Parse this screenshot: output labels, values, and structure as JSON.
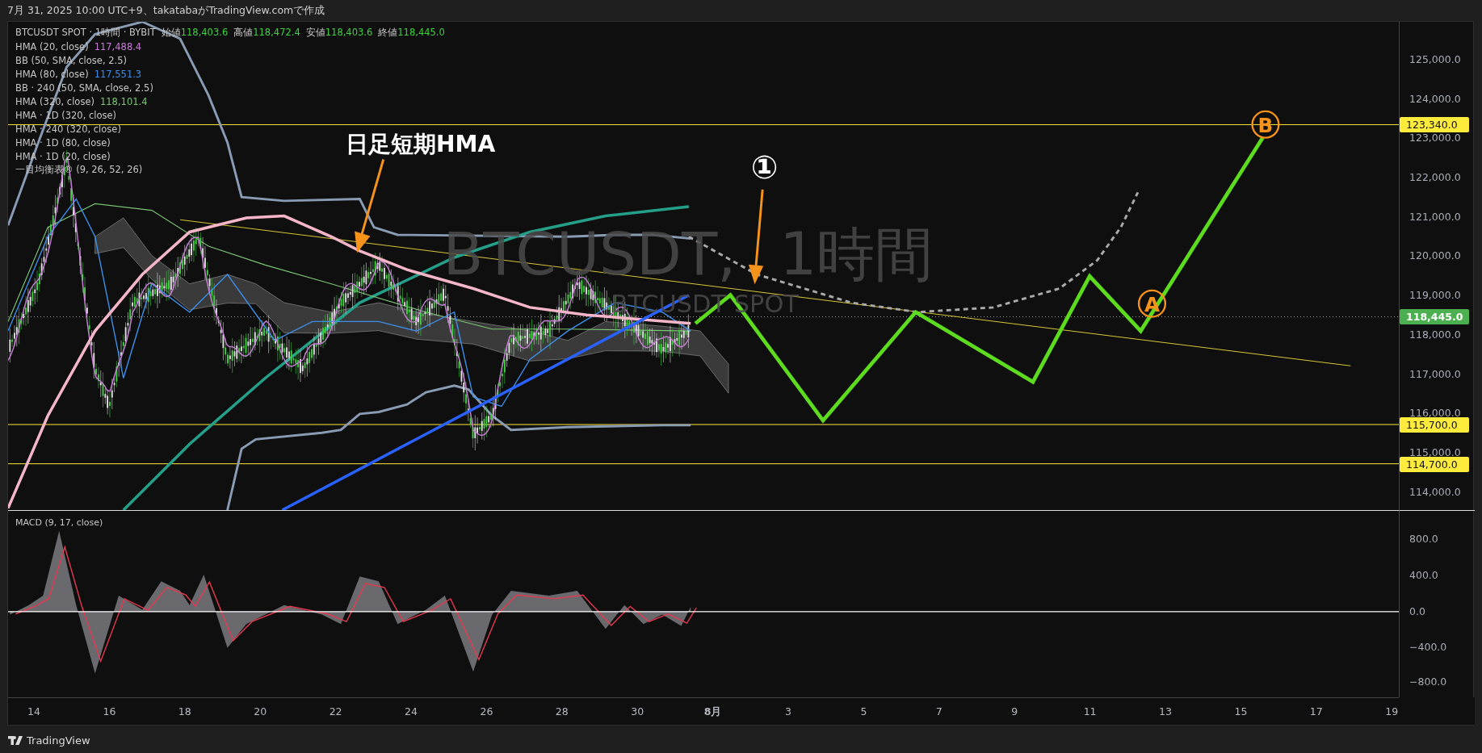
{
  "header": {
    "caption": "7月 31, 2025 10:00 UTC+9、takatabaがTradingView.comで作成"
  },
  "legend": {
    "symbol": "BTCUSDT SPOT · 1時間 · BYBIT",
    "ohlc": [
      {
        "label": "始値",
        "value": "118,403.6"
      },
      {
        "label": "高値",
        "value": "118,472.4"
      },
      {
        "label": "安値",
        "value": "118,403.6"
      },
      {
        "label": "終値",
        "value": "118,445.0"
      }
    ],
    "indicators": [
      {
        "name": "HMA (20, close)",
        "value": "117,488.4",
        "color": "#c77dd6"
      },
      {
        "name": "BB (50, SMA, close, 2.5)"
      },
      {
        "name": "HMA (80, close)",
        "value": "117,551.3",
        "color": "#3d8ee8"
      },
      {
        "name": "BB · 240 (50, SMA, close, 2.5)"
      },
      {
        "name": "HMA (320, close)",
        "value": "118,101.4",
        "color": "#7cc576"
      },
      {
        "name": "HMA · 1D (320, close)"
      },
      {
        "name": "HMA · 240 (320, close)"
      },
      {
        "name": "HMA · 1D (80, close)"
      },
      {
        "name": "HMA · 1D (20, close)"
      },
      {
        "name": "一目均衡表® (9, 26, 52, 26)"
      }
    ]
  },
  "watermark": {
    "symbol": "BTCUSDT,",
    "interval": "1時間",
    "subtitle": "BTCUSDT SPOT"
  },
  "annotations": {
    "callout": "日足短期HMA",
    "marker": "①",
    "points": [
      {
        "letter": "A"
      },
      {
        "letter": "B"
      }
    ]
  },
  "price_axis": {
    "ticks": [
      "125,000.0",
      "124,000.0",
      "123,000.0",
      "122,000.0",
      "121,000.0",
      "120,000.0",
      "119,000.0",
      "118,000.0",
      "117,000.0",
      "116,000.0",
      "115,000.0",
      "114,000.0"
    ],
    "labels": [
      {
        "value": "123,340.0",
        "kind": "level",
        "color": "#ffeb3b"
      },
      {
        "value": "118,445.0",
        "kind": "last",
        "color": "#4caf50"
      },
      {
        "value": "115,700.0",
        "kind": "level",
        "color": "#ffeb3b"
      },
      {
        "value": "114,700.0",
        "kind": "level",
        "color": "#ffeb3b"
      }
    ]
  },
  "macd": {
    "title": "MACD (9, 17, close)",
    "ticks": [
      "800.0",
      "400.0",
      "0.0",
      "−400.0",
      "−800.0"
    ]
  },
  "time_axis": [
    {
      "label": "14",
      "kind": "day"
    },
    {
      "label": "16",
      "kind": "day"
    },
    {
      "label": "18",
      "kind": "day"
    },
    {
      "label": "20",
      "kind": "day"
    },
    {
      "label": "22",
      "kind": "day"
    },
    {
      "label": "24",
      "kind": "day"
    },
    {
      "label": "26",
      "kind": "day"
    },
    {
      "label": "28",
      "kind": "day"
    },
    {
      "label": "30",
      "kind": "day"
    },
    {
      "label": "8月",
      "kind": "month"
    },
    {
      "label": "3",
      "kind": "day"
    },
    {
      "label": "5",
      "kind": "day"
    },
    {
      "label": "7",
      "kind": "day"
    },
    {
      "label": "9",
      "kind": "day"
    },
    {
      "label": "11",
      "kind": "day"
    },
    {
      "label": "13",
      "kind": "day"
    },
    {
      "label": "15",
      "kind": "day"
    },
    {
      "label": "17",
      "kind": "day"
    },
    {
      "label": "19",
      "kind": "day"
    }
  ],
  "footer": {
    "brand": "TradingView"
  }
}
